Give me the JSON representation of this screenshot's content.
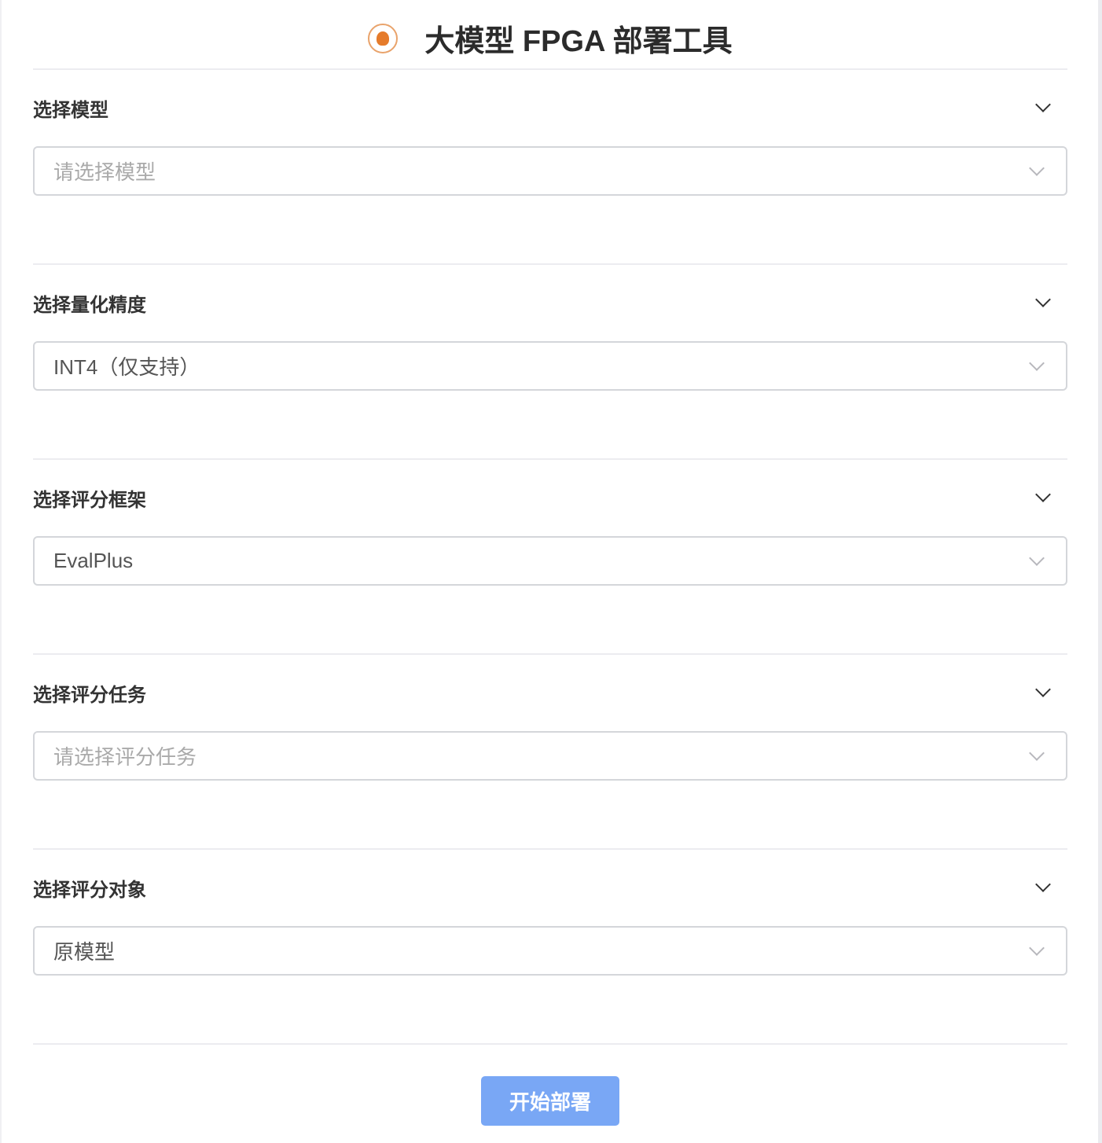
{
  "header": {
    "title": "大模型 FPGA 部署工具",
    "logo_icon": "university-seal-logo"
  },
  "sections": [
    {
      "title": "选择模型",
      "value": "",
      "placeholder": "请选择模型"
    },
    {
      "title": "选择量化精度",
      "value": "INT4（仅支持）",
      "placeholder": ""
    },
    {
      "title": "选择评分框架",
      "value": "EvalPlus",
      "placeholder": ""
    },
    {
      "title": "选择评分任务",
      "value": "",
      "placeholder": "请选择评分任务"
    },
    {
      "title": "选择评分对象",
      "value": "原模型",
      "placeholder": ""
    }
  ],
  "deploy_button": "开始部署",
  "colors": {
    "button": "#79a7f5",
    "logo": "#e57b2b"
  }
}
